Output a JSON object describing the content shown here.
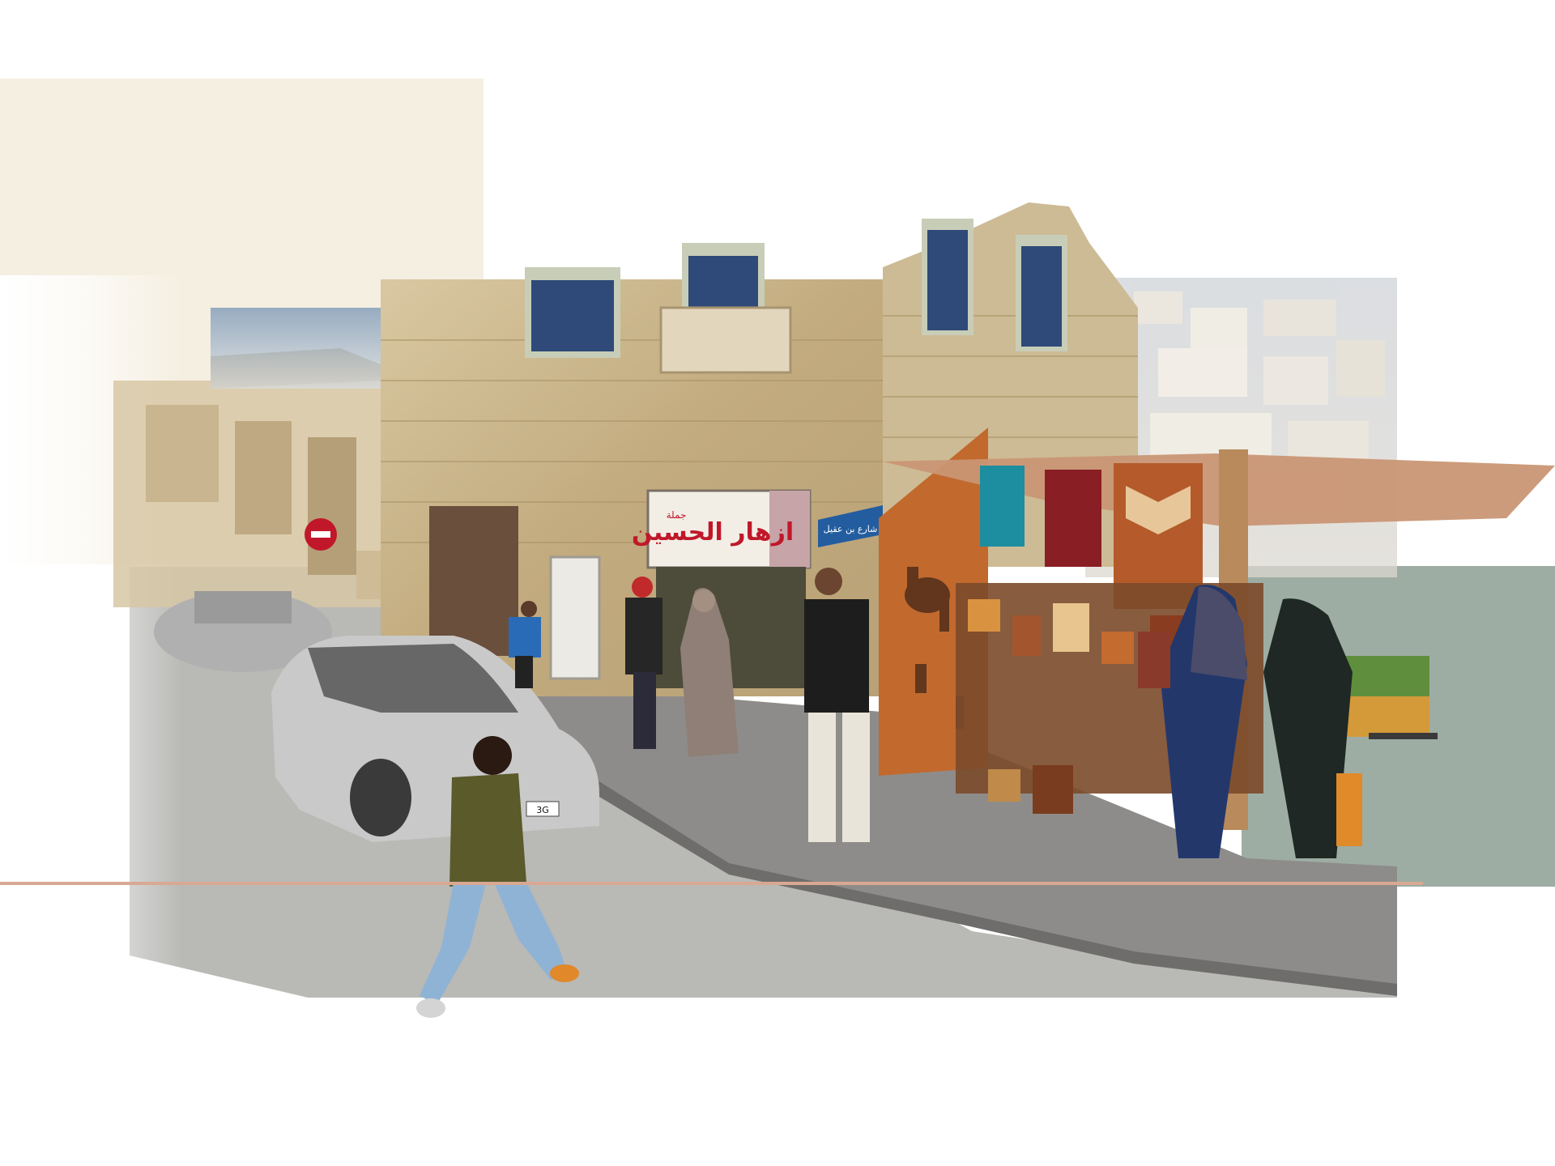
{
  "palette": {
    "background": "#ffffff",
    "cream_block": "#f5efe1",
    "sage_block": "#9eada4",
    "accent_line": "#d9a892",
    "stone": "#cdb88f",
    "stone_dark": "#a99265",
    "street": "#b9b9b6",
    "sidewalk": "#8e8c8a",
    "window_frame": "#c8cdb8",
    "window_glass": "#2f4a78",
    "awning": "#c99674",
    "corten": "#c2692e",
    "sign_blue": "#235da0",
    "sign_red": "#c0182a"
  },
  "signs": {
    "shop_sign_text": "ازهار الحسين",
    "shop_sign_small": "جملة",
    "street_sign_text": "شارع بن عقيل"
  },
  "car_plate": "3G",
  "figures": [
    "boy-running",
    "man-black-shirt",
    "woman-grey-robe",
    "woman-black-coat",
    "woman-blue-dress",
    "woman-black-dress",
    "child-blue-jacket"
  ]
}
